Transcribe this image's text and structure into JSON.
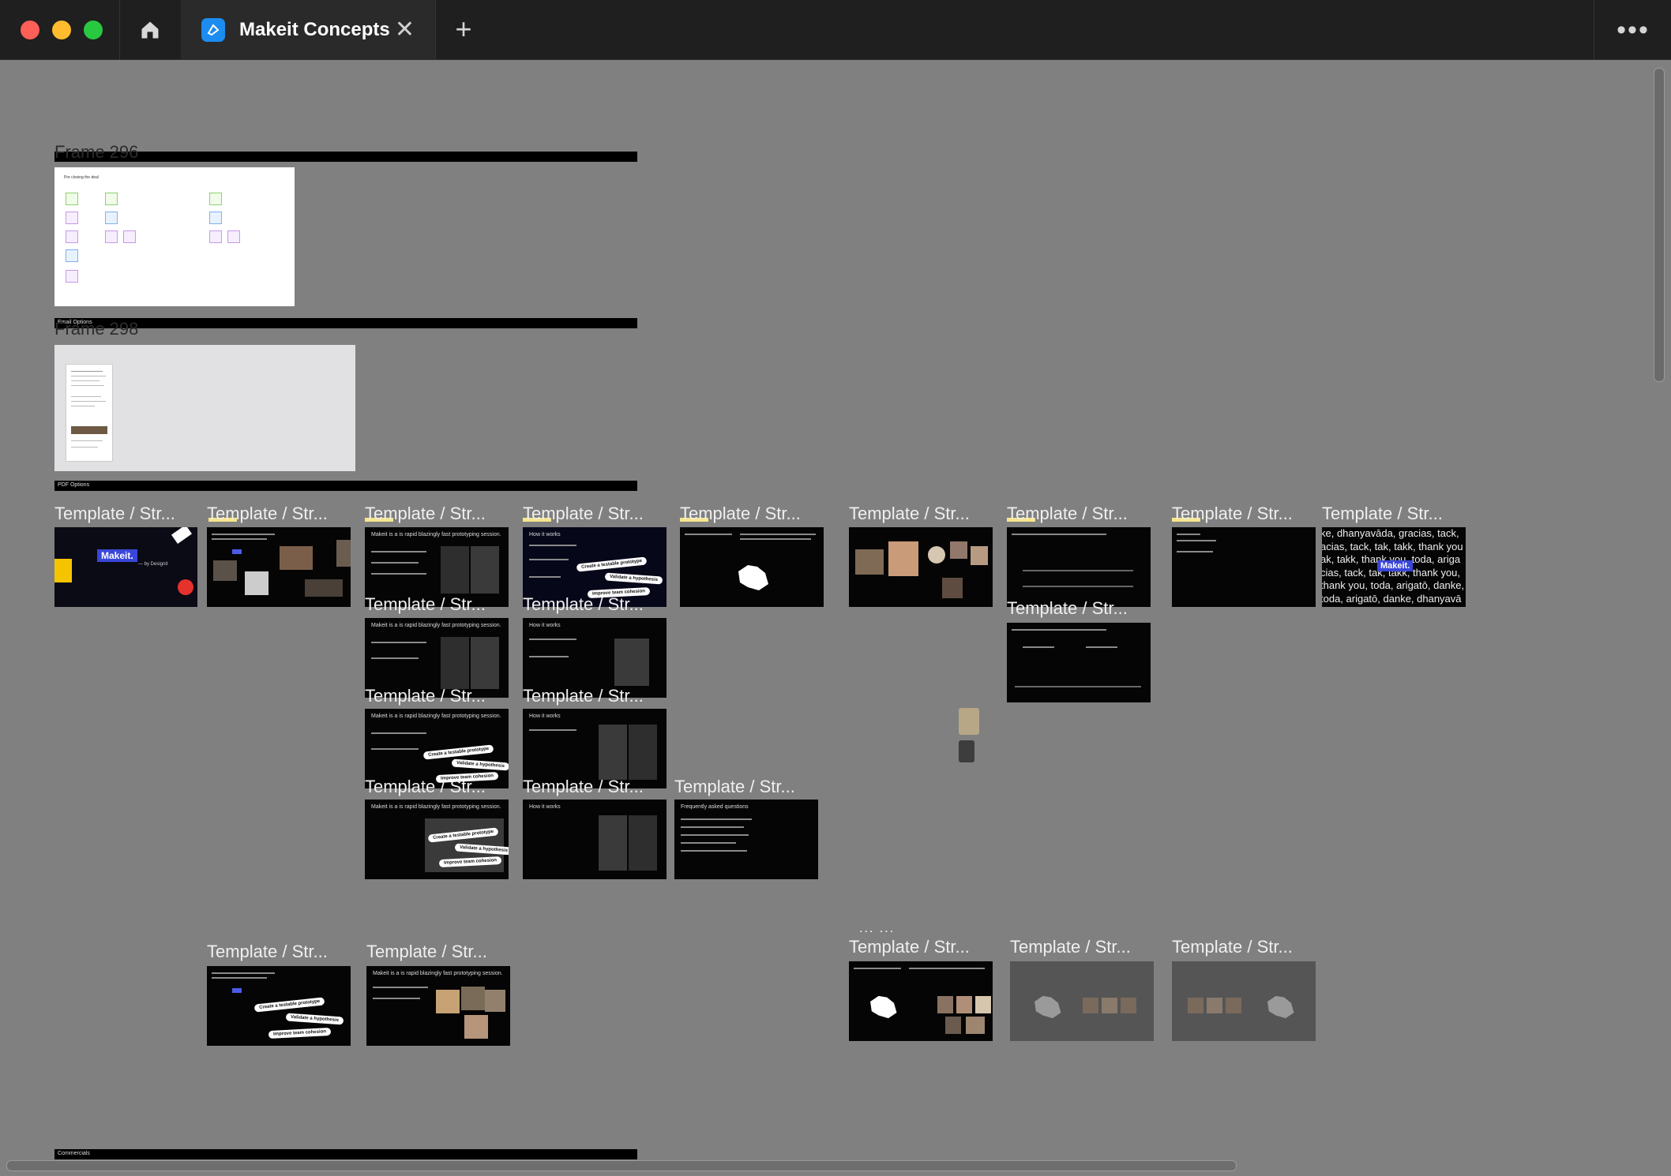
{
  "window": {
    "tab_title": "Makeit Concepts",
    "tab_close_glyph": "✕",
    "new_tab_glyph": "+",
    "more_glyph": "•••"
  },
  "canvas": {
    "frames": [
      {
        "label": "Frame 296"
      },
      {
        "label": "Frame 298"
      }
    ],
    "sections": [
      {
        "label": "Email Options"
      },
      {
        "label": "PDF Options"
      },
      {
        "label": "Commercials"
      }
    ],
    "thumb_label": "Template / Str...",
    "slide_text": {
      "makeit_logo": "Makeit.",
      "by_designit": "— by Designit",
      "rapid": "Makeit is a is rapid blazingly fast prototyping session.",
      "how_it_works": "How it works",
      "faq": "Frequently asked questions",
      "pill1": "Create a testable prototype",
      "pill2": "Validate a hypothesis",
      "pill3": "Improve team cohesion",
      "thanks_lines": [
        "ke, dhanyavāda, gracias, tack,",
        "acias, tack, tak, takk, thank you",
        "ak, takk, thank you, toda, ariga",
        "cias, tack, tak, takk, thank you,",
        "thank you, toda, arigatō, danke,",
        "toda, arigatō, danke, dhanyavā"
      ],
      "pre_closing": "Pre closing the deal",
      "ellipsis": "... ..."
    }
  },
  "colors": {
    "canvas_bg": "#808080",
    "titlebar_bg": "#1f1f1f",
    "accent_blue": "#1c8cf0",
    "label_highlight": "#f6e58d",
    "traffic_red": "#fe5f57",
    "traffic_yellow": "#febc2e",
    "traffic_green": "#28c840"
  },
  "icons": [
    "home-icon",
    "makeit-app-icon",
    "close-icon",
    "plus-icon",
    "more-icon"
  ]
}
